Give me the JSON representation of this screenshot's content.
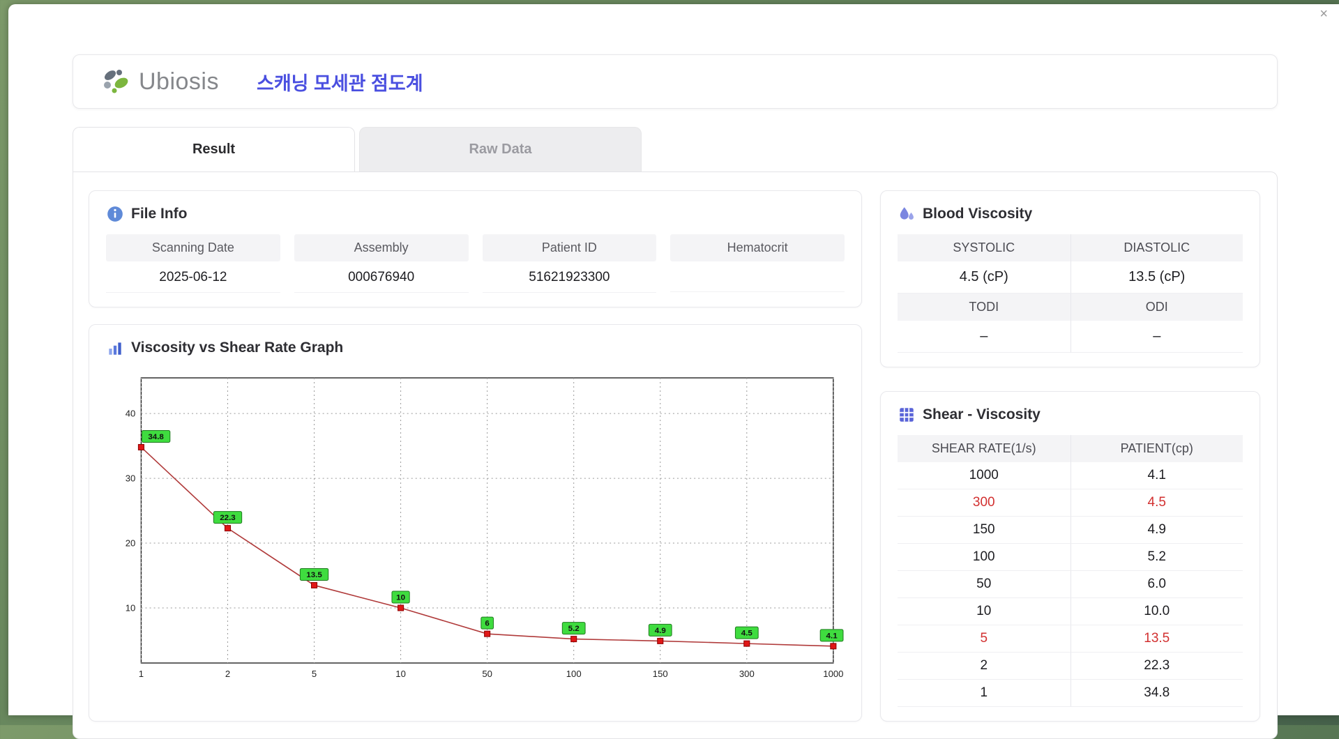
{
  "colors": {
    "accent": "#4a4fe0",
    "highlight_red": "#d23030",
    "label_green": "#3fdc3f"
  },
  "window": {
    "close_label": "×"
  },
  "header": {
    "brand": "Ubiosis",
    "title": "스캐닝 모세관 점도계"
  },
  "tabs": [
    {
      "label": "Result"
    },
    {
      "label": "Raw Data"
    }
  ],
  "file_info": {
    "title": "File Info",
    "fields": [
      {
        "label": "Scanning Date",
        "value": "2025-06-12"
      },
      {
        "label": "Assembly",
        "value": "000676940"
      },
      {
        "label": "Patient ID",
        "value": "51621923300"
      },
      {
        "label": "Hematocrit",
        "value": ""
      }
    ]
  },
  "graph": {
    "title": "Viscosity vs Shear Rate Graph"
  },
  "blood_viscosity": {
    "title": "Blood Viscosity",
    "columns_top": [
      "SYSTOLIC",
      "DIASTOLIC"
    ],
    "values_top": [
      "4.5 (cP)",
      "13.5 (cP)"
    ],
    "columns_bottom": [
      "TODI",
      "ODI"
    ],
    "values_bottom": [
      "–",
      "–"
    ]
  },
  "shear_viscosity": {
    "title": "Shear - Viscosity",
    "columns": [
      "SHEAR RATE(1/s)",
      "PATIENT(cp)"
    ],
    "rows": [
      {
        "shear": "1000",
        "patient": "4.1",
        "highlight": false
      },
      {
        "shear": "300",
        "patient": "4.5",
        "highlight": true
      },
      {
        "shear": "150",
        "patient": "4.9",
        "highlight": false
      },
      {
        "shear": "100",
        "patient": "5.2",
        "highlight": false
      },
      {
        "shear": "50",
        "patient": "6.0",
        "highlight": false
      },
      {
        "shear": "10",
        "patient": "10.0",
        "highlight": false
      },
      {
        "shear": "5",
        "patient": "13.5",
        "highlight": true
      },
      {
        "shear": "2",
        "patient": "22.3",
        "highlight": false
      },
      {
        "shear": "1",
        "patient": "34.8",
        "highlight": false
      }
    ]
  },
  "chart_data": {
    "type": "line",
    "title": "Viscosity vs Shear Rate Graph",
    "x_categories": [
      1,
      2,
      5,
      10,
      50,
      100,
      150,
      300,
      1000
    ],
    "values": [
      34.8,
      22.3,
      13.5,
      10,
      6,
      5.2,
      4.9,
      4.5,
      4.1
    ],
    "point_labels": [
      "34.8",
      "22.3",
      "13.5",
      "10",
      "6",
      "5.2",
      "4.9",
      "4.5",
      "4.1"
    ],
    "xlabel": "",
    "ylabel": "",
    "x_axis_type": "categorical-evenly-spaced",
    "ylim": [
      1.5,
      45.5
    ],
    "yticks": [
      10,
      20,
      30,
      40
    ],
    "grid": true,
    "legend": false,
    "line_color": "#b03a3a",
    "marker_color": "#e01717",
    "label_bg": "#3fdc3f"
  }
}
